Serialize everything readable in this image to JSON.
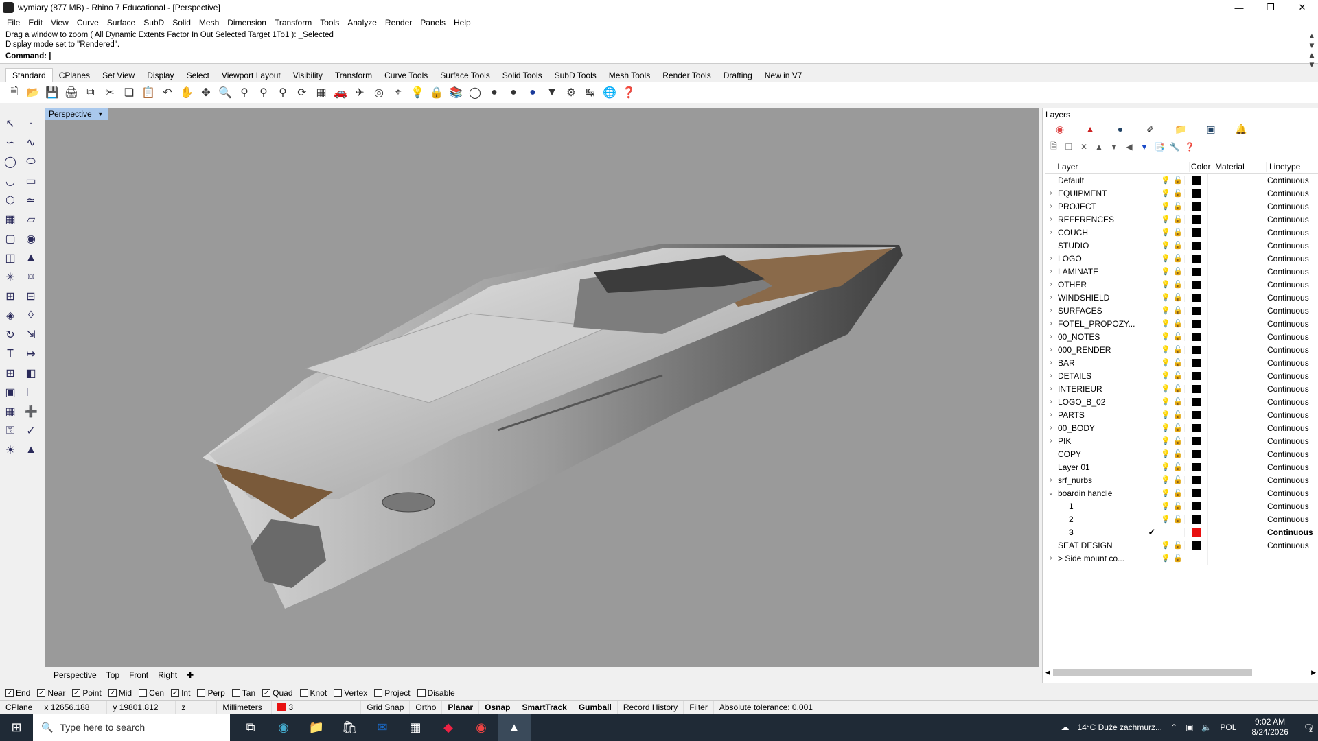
{
  "window": {
    "title": "wymiary (877 MB) - Rhino 7 Educational - [Perspective]"
  },
  "menu": [
    "File",
    "Edit",
    "View",
    "Curve",
    "Surface",
    "SubD",
    "Solid",
    "Mesh",
    "Dimension",
    "Transform",
    "Tools",
    "Analyze",
    "Render",
    "Panels",
    "Help"
  ],
  "command": {
    "history1": "Drag a window to zoom ( All  Dynamic  Extents  Factor  In  Out  Selected  Target  1To1 ): _Selected",
    "history2": "Display mode set to \"Rendered\".",
    "prompt": "Command:"
  },
  "toolbar_tabs": [
    "Standard",
    "CPlanes",
    "Set View",
    "Display",
    "Select",
    "Viewport Layout",
    "Visibility",
    "Transform",
    "Curve Tools",
    "Surface Tools",
    "Solid Tools",
    "SubD Tools",
    "Mesh Tools",
    "Render Tools",
    "Drafting",
    "New in V7"
  ],
  "viewport": {
    "label": "Perspective"
  },
  "view_tabs": [
    "Perspective",
    "Top",
    "Front",
    "Right"
  ],
  "layers_panel": {
    "title": "Layers",
    "headers": {
      "layer": "Layer",
      "color": "Color",
      "material": "Material",
      "linetype": "Linetype"
    },
    "rows": [
      {
        "name": "Default",
        "expand": "",
        "color": "#000000",
        "linetype": "Continuous"
      },
      {
        "name": "EQUIPMENT",
        "expand": ">",
        "color": "#000000",
        "linetype": "Continuous"
      },
      {
        "name": "PROJECT",
        "expand": ">",
        "color": "#000000",
        "linetype": "Continuous"
      },
      {
        "name": "REFERENCES",
        "expand": ">",
        "color": "#000000",
        "linetype": "Continuous"
      },
      {
        "name": "COUCH",
        "expand": ">",
        "color": "#000000",
        "linetype": "Continuous"
      },
      {
        "name": "STUDIO",
        "expand": "",
        "color": "#000000",
        "linetype": "Continuous"
      },
      {
        "name": "LOGO",
        "expand": ">",
        "color": "#000000",
        "linetype": "Continuous"
      },
      {
        "name": "LAMINATE",
        "expand": ">",
        "color": "#000000",
        "linetype": "Continuous"
      },
      {
        "name": "OTHER",
        "expand": ">",
        "color": "#000000",
        "linetype": "Continuous"
      },
      {
        "name": "WINDSHIELD",
        "expand": ">",
        "color": "#000000",
        "linetype": "Continuous"
      },
      {
        "name": "SURFACES",
        "expand": ">",
        "color": "#000000",
        "linetype": "Continuous"
      },
      {
        "name": "FOTEL_PROPOZY...",
        "expand": ">",
        "color": "#000000",
        "linetype": "Continuous"
      },
      {
        "name": "00_NOTES",
        "expand": ">",
        "color": "#000000",
        "linetype": "Continuous"
      },
      {
        "name": "000_RENDER",
        "expand": ">",
        "color": "#000000",
        "linetype": "Continuous"
      },
      {
        "name": "BAR",
        "expand": ">",
        "color": "#000000",
        "linetype": "Continuous"
      },
      {
        "name": "DETAILS",
        "expand": ">",
        "color": "#000000",
        "linetype": "Continuous"
      },
      {
        "name": "INTERIEUR",
        "expand": ">",
        "color": "#000000",
        "linetype": "Continuous"
      },
      {
        "name": "LOGO_B_02",
        "expand": ">",
        "color": "#000000",
        "linetype": "Continuous"
      },
      {
        "name": "PARTS",
        "expand": ">",
        "color": "#000000",
        "linetype": "Continuous"
      },
      {
        "name": "00_BODY",
        "expand": ">",
        "color": "#000000",
        "linetype": "Continuous"
      },
      {
        "name": "PIK",
        "expand": ">",
        "color": "#000000",
        "linetype": "Continuous"
      },
      {
        "name": "COPY",
        "expand": "",
        "color": "#000000",
        "linetype": "Continuous"
      },
      {
        "name": "Layer 01",
        "expand": "",
        "color": "#000000",
        "linetype": "Continuous"
      },
      {
        "name": "srf_nurbs",
        "expand": ">",
        "color": "#000000",
        "linetype": "Continuous"
      },
      {
        "name": "boardin handle",
        "expand": "v",
        "color": "#000000",
        "linetype": "Continuous"
      },
      {
        "name": "1",
        "expand": "",
        "color": "#000000",
        "linetype": "Continuous",
        "child": true
      },
      {
        "name": "2",
        "expand": "",
        "color": "#000000",
        "linetype": "Continuous",
        "child": true
      },
      {
        "name": "3",
        "expand": "",
        "color": "#e81010",
        "linetype": "Continuous",
        "child": true,
        "current": true
      },
      {
        "name": "SEAT DESIGN",
        "expand": "",
        "color": "#000000",
        "linetype": "Continuous"
      },
      {
        "name": "> Side mount co...",
        "expand": ">",
        "color": "",
        "linetype": ""
      }
    ]
  },
  "osnaps": [
    {
      "label": "End",
      "checked": true
    },
    {
      "label": "Near",
      "checked": true
    },
    {
      "label": "Point",
      "checked": true
    },
    {
      "label": "Mid",
      "checked": true
    },
    {
      "label": "Cen",
      "checked": false
    },
    {
      "label": "Int",
      "checked": true
    },
    {
      "label": "Perp",
      "checked": false
    },
    {
      "label": "Tan",
      "checked": false
    },
    {
      "label": "Quad",
      "checked": true
    },
    {
      "label": "Knot",
      "checked": false
    },
    {
      "label": "Vertex",
      "checked": false
    },
    {
      "label": "Project",
      "checked": false
    },
    {
      "label": "Disable",
      "checked": false
    }
  ],
  "status": {
    "cplane": "CPlane",
    "x": "x 12656.188",
    "y": "y 19801.812",
    "z": "z",
    "units": "Millimeters",
    "layer": "3",
    "layer_color": "#e81010",
    "grid_snap": "Grid Snap",
    "ortho": "Ortho",
    "planar": "Planar",
    "osnap": "Osnap",
    "smarttrack": "SmartTrack",
    "gumball": "Gumball",
    "record_history": "Record History",
    "filter": "Filter",
    "tolerance": "Absolute tolerance: 0.001"
  },
  "taskbar": {
    "search_placeholder": "Type here to search",
    "weather": "14°C  Duże zachmurz...",
    "lang": "POL",
    "time": "9:02 AM",
    "date": "8/24/2026",
    "notif": "2"
  }
}
